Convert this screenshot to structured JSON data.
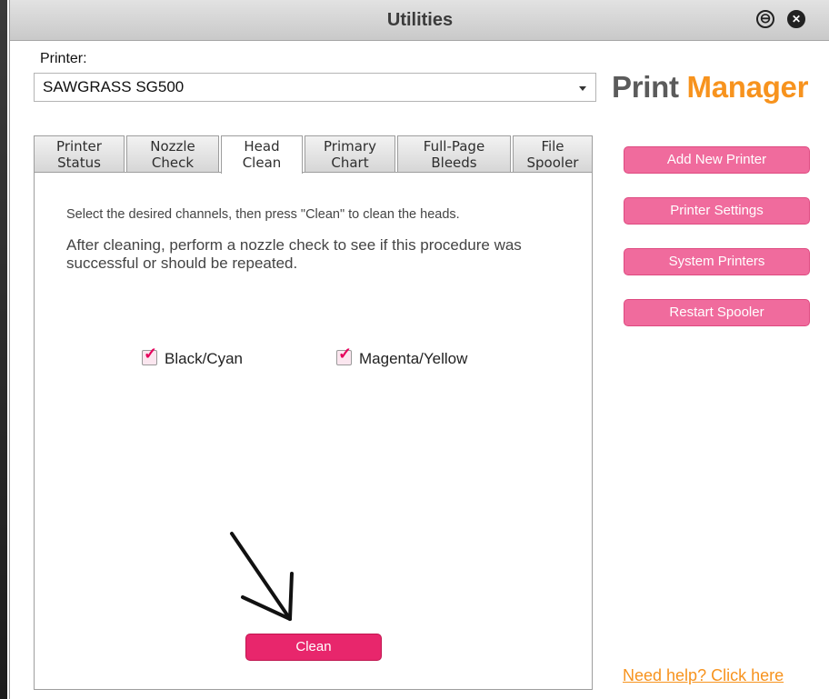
{
  "window": {
    "title": "Utilities",
    "minimize_glyph": "⊖",
    "close_glyph": "✕"
  },
  "printer": {
    "label": "Printer:",
    "selected": "SAWGRASS SG500"
  },
  "brand": {
    "part1": "Print",
    "part2": "Manager",
    "accent_color": "#f7931e"
  },
  "tabs": [
    {
      "line1": "Printer",
      "line2": "Status"
    },
    {
      "line1": "Nozzle",
      "line2": "Check"
    },
    {
      "line1": "Head",
      "line2": "Clean"
    },
    {
      "line1": "Primary",
      "line2": "Chart"
    },
    {
      "line1": "Full-Page",
      "line2": "Bleeds"
    },
    {
      "line1": "File",
      "line2": "Spooler"
    }
  ],
  "active_tab": "Head Clean",
  "panel": {
    "instruction": "Select the desired channels, then press \"Clean\" to clean the heads.",
    "note": "After cleaning, perform a nozzle check to see if this procedure was successful or should be repeated.",
    "channels": [
      {
        "label": "Black/Cyan",
        "checked": true
      },
      {
        "label": "Magenta/Yellow",
        "checked": true
      }
    ],
    "clean_button": "Clean"
  },
  "side_buttons": {
    "add_new_printer": "Add New Printer",
    "printer_settings": "Printer Settings",
    "system_printers": "System Printers",
    "restart_spooler": "Restart Spooler"
  },
  "help_link": "Need help? Click here",
  "colors": {
    "pink_button": "#f06b9d",
    "clean_button": "#e8266c",
    "check_tick": "#e6005c"
  },
  "icons": {
    "minimize": "minimize-icon",
    "close": "close-icon",
    "dropdown": "chevron-down-icon",
    "check": "checkmark-icon"
  }
}
